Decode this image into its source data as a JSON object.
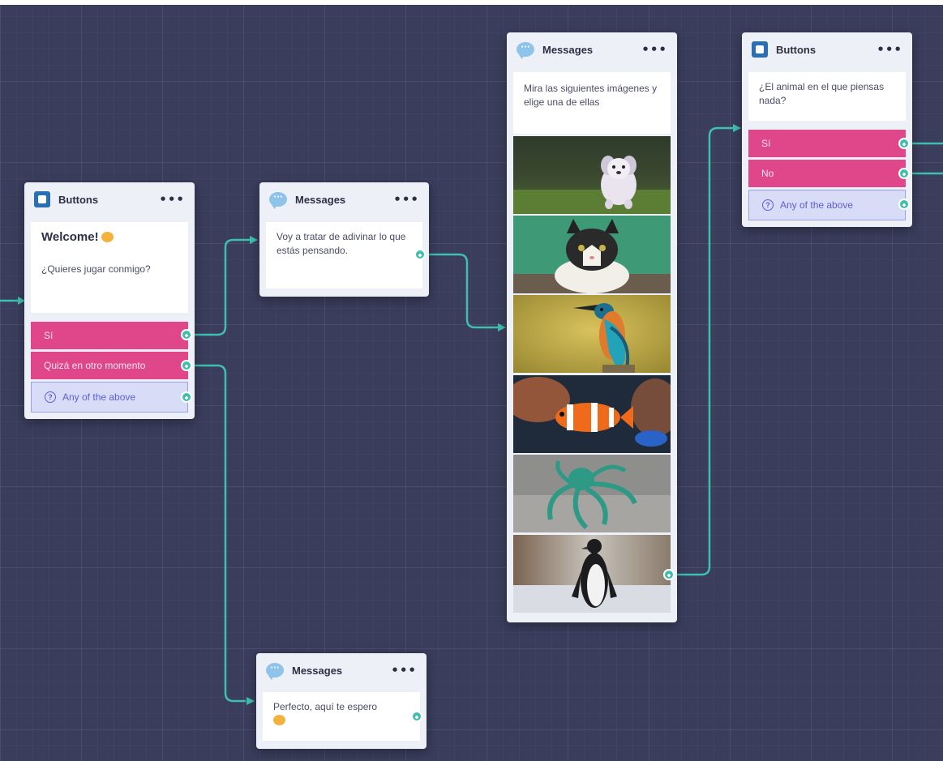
{
  "colors": {
    "canvas": "#3a3d5c",
    "wire": "#3fbfae",
    "choice": "#e0468a",
    "fallback": "#d9dcf6",
    "buttons_icon": "#2a6fb5",
    "messages_icon": "#8ec3ea"
  },
  "node_welcome": {
    "type": "Buttons",
    "icon": "square-block-icon",
    "menu": "•••",
    "heading": "Welcome!",
    "heading_emoji": "hugging-face-emoji",
    "text": "¿Quieres jugar conmigo?",
    "options": [
      "Sí",
      "Quizá en otro momento"
    ],
    "fallback": "Any of the above"
  },
  "node_guess": {
    "type": "Messages",
    "icon": "speech-bubble-icon",
    "menu": "•••",
    "text": "Voy a tratar de adivinar lo que estás pensando."
  },
  "node_images": {
    "type": "Messages",
    "icon": "speech-bubble-icon",
    "menu": "•••",
    "text": "Mira las siguientes imágenes y elige una de ellas",
    "images": [
      "dog",
      "cat",
      "kingfisher",
      "clownfish",
      "octopus",
      "penguin"
    ]
  },
  "node_question": {
    "type": "Buttons",
    "icon": "square-block-icon",
    "menu": "•••",
    "text": "¿El animal en el que piensas nada?",
    "options": [
      "Sí",
      "No"
    ],
    "fallback": "Any of the above"
  },
  "node_wait": {
    "type": "Messages",
    "icon": "speech-bubble-icon",
    "menu": "•••",
    "text": "Perfecto, aquí te espero",
    "emoji": "hugging-face-emoji"
  }
}
